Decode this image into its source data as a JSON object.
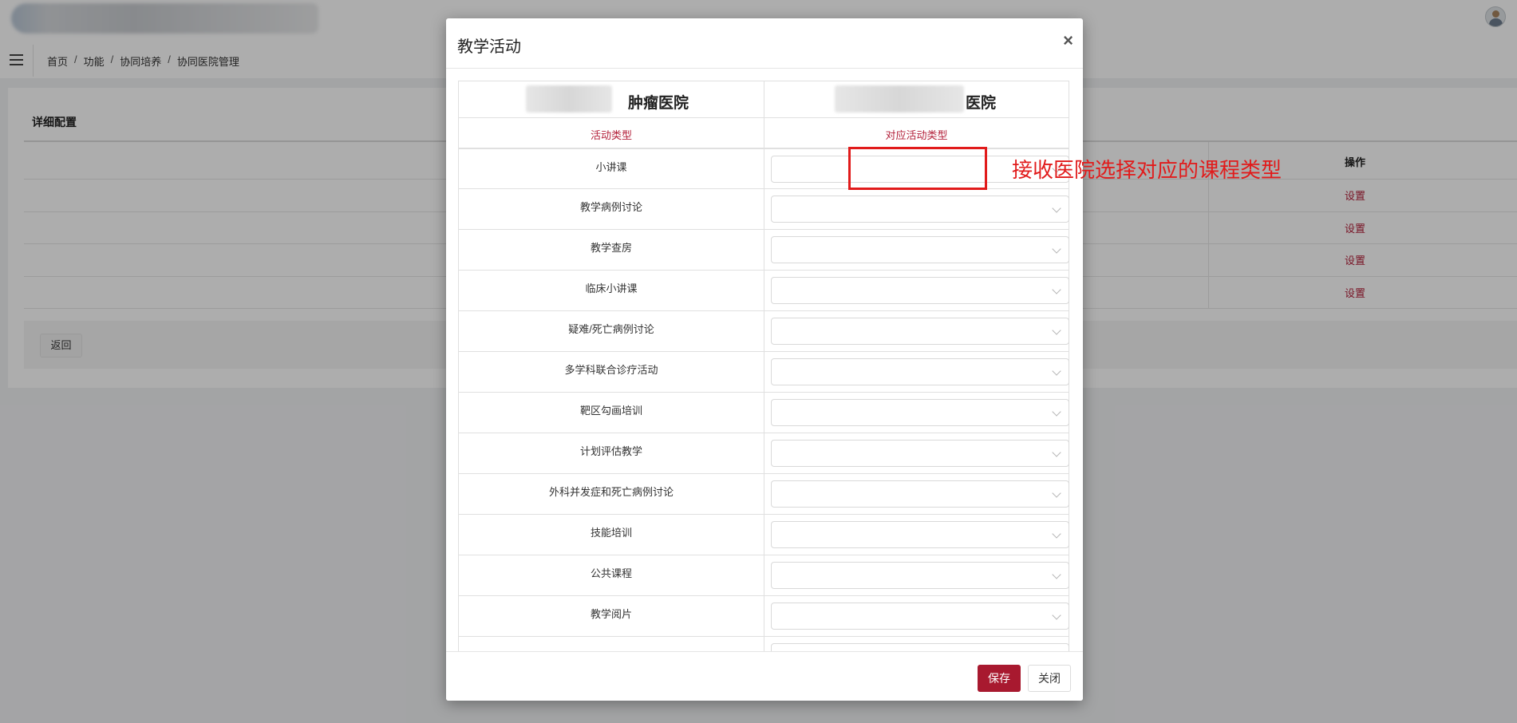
{
  "breadcrumb": [
    "首页",
    "功能",
    "协同培养",
    "协同医院管理"
  ],
  "breadcrumb_separator": "/",
  "card": {
    "title": "详细配置",
    "operation_header": "操作",
    "row_action": "设置",
    "back_button": "返回"
  },
  "modal": {
    "title": "教学活动",
    "close_symbol": "×",
    "left_hospital": "肿瘤医院",
    "right_hospital": "医院",
    "left_column_header": "活动类型",
    "right_column_header": "对应活动类型",
    "activities": [
      "小讲课",
      "教学病例讨论",
      "教学查房",
      "临床小讲课",
      "疑难/死亡病例讨论",
      "多学科联合诊疗活动",
      "靶区勾画培训",
      "计划评估教学",
      "外科并发症和死亡病例讨论",
      "技能培训",
      "公共课程",
      "教学阅片"
    ],
    "save_button": "保存",
    "close_button": "关闭"
  },
  "annotation": {
    "text": "接收医院选择对应的课程类型",
    "color": "#e11b1b"
  },
  "colors": {
    "accent": "#a8192f",
    "link": "#b3203a"
  }
}
